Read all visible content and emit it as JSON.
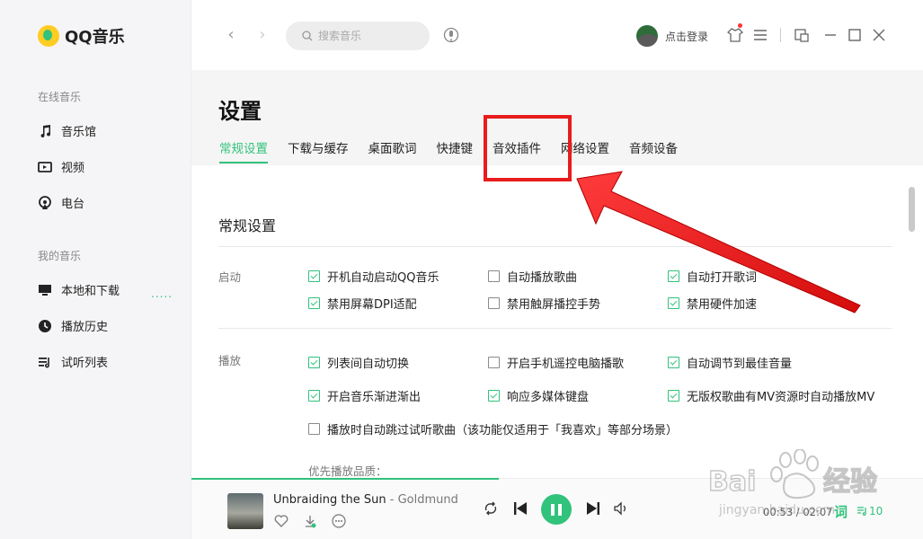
{
  "app": {
    "name": "QQ音乐"
  },
  "sidebar": {
    "online_section": "在线音乐",
    "online_items": [
      {
        "label": "音乐馆",
        "icon": "music-note-icon"
      },
      {
        "label": "视频",
        "icon": "video-icon"
      },
      {
        "label": "电台",
        "icon": "radio-icon"
      }
    ],
    "my_section": "我的音乐",
    "my_items": [
      {
        "label": "本地和下载",
        "icon": "monitor-icon",
        "status": "....."
      },
      {
        "label": "播放历史",
        "icon": "history-icon"
      },
      {
        "label": "试听列表",
        "icon": "playlist-icon"
      }
    ]
  },
  "topbar": {
    "back": "‹",
    "forward": "›",
    "search_placeholder": "搜索音乐",
    "login_label": "点击登录"
  },
  "settings": {
    "title": "设置",
    "tabs": [
      "常规设置",
      "下载与缓存",
      "桌面歌词",
      "快捷键",
      "音效插件",
      "网络设置",
      "音频设备"
    ],
    "active_tab": "常规设置",
    "section_title": "常规设置",
    "groups": {
      "startup": {
        "label": "启动",
        "options": [
          {
            "label": "开机自动启动QQ音乐",
            "checked": true
          },
          {
            "label": "自动播放歌曲",
            "checked": false
          },
          {
            "label": "自动打开歌词",
            "checked": true
          },
          {
            "label": "禁用屏幕DPI适配",
            "checked": true
          },
          {
            "label": "禁用触屏播控手势",
            "checked": false
          },
          {
            "label": "禁用硬件加速",
            "checked": true
          }
        ]
      },
      "playback": {
        "label": "播放",
        "options": [
          {
            "label": "列表间自动切换",
            "checked": true
          },
          {
            "label": "开启手机遥控电脑播歌",
            "checked": false
          },
          {
            "label": "自动调节到最佳音量",
            "checked": true
          },
          {
            "label": "开启音乐渐进渐出",
            "checked": true
          },
          {
            "label": "响应多媒体键盘",
            "checked": true
          },
          {
            "label": "无版权歌曲有MV资源时自动播放MV",
            "checked": true
          },
          {
            "label": "播放时自动跳过试听歌曲（该功能仅适用于「我喜欢」等部分场景）",
            "checked": false
          }
        ]
      }
    },
    "quality_label": "优先播放品质："
  },
  "player": {
    "song_title": "Unbraiding the Sun",
    "separator": " - ",
    "artist": "Goldmund",
    "time_current": "00:53",
    "time_total": "02:07",
    "time_sep": " / ",
    "lyric_label": "词",
    "playlist_count": "10",
    "progress": 0.42
  },
  "colors": {
    "accent": "#31c27c",
    "highlight": "#e81c1c"
  }
}
